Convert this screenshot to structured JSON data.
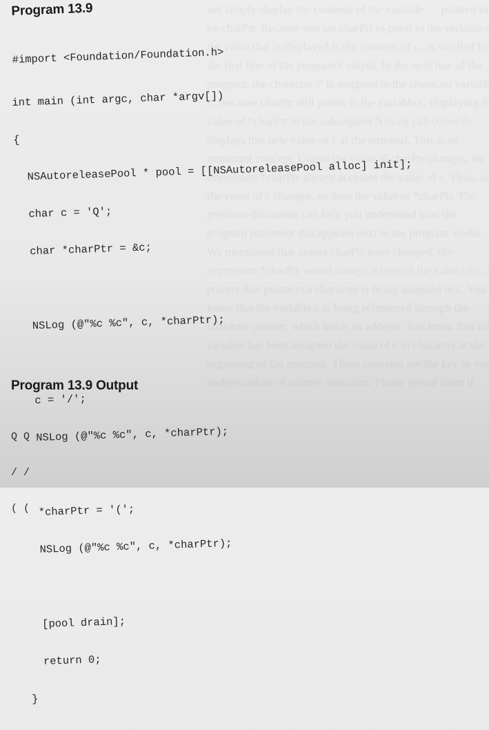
{
  "program_title": "Program 13.9",
  "import_line": "#import <Foundation/Foundation.h>",
  "code_lines": [
    "int main (int argc, char *argv[])",
    "{",
    "  NSAutoreleasePool * pool = [[NSAutoreleasePool alloc] init];",
    "  char c = 'Q';",
    "  char *charPtr = &c;",
    "",
    "  NSLog (@\"%c %c\", c, *charPtr);",
    "",
    "  c = '/';",
    "  NSLog (@\"%c %c\", c, *charPtr);",
    "",
    "  *charPtr = '(';",
    "  NSLog (@\"%c %c\", c, *charPtr);",
    "",
    "  [pool drain];",
    "  return 0;",
    "}"
  ],
  "output_title": "Program 13.9 Output",
  "output_lines": [
    "Q Q",
    "/ /",
    "( ("
  ]
}
